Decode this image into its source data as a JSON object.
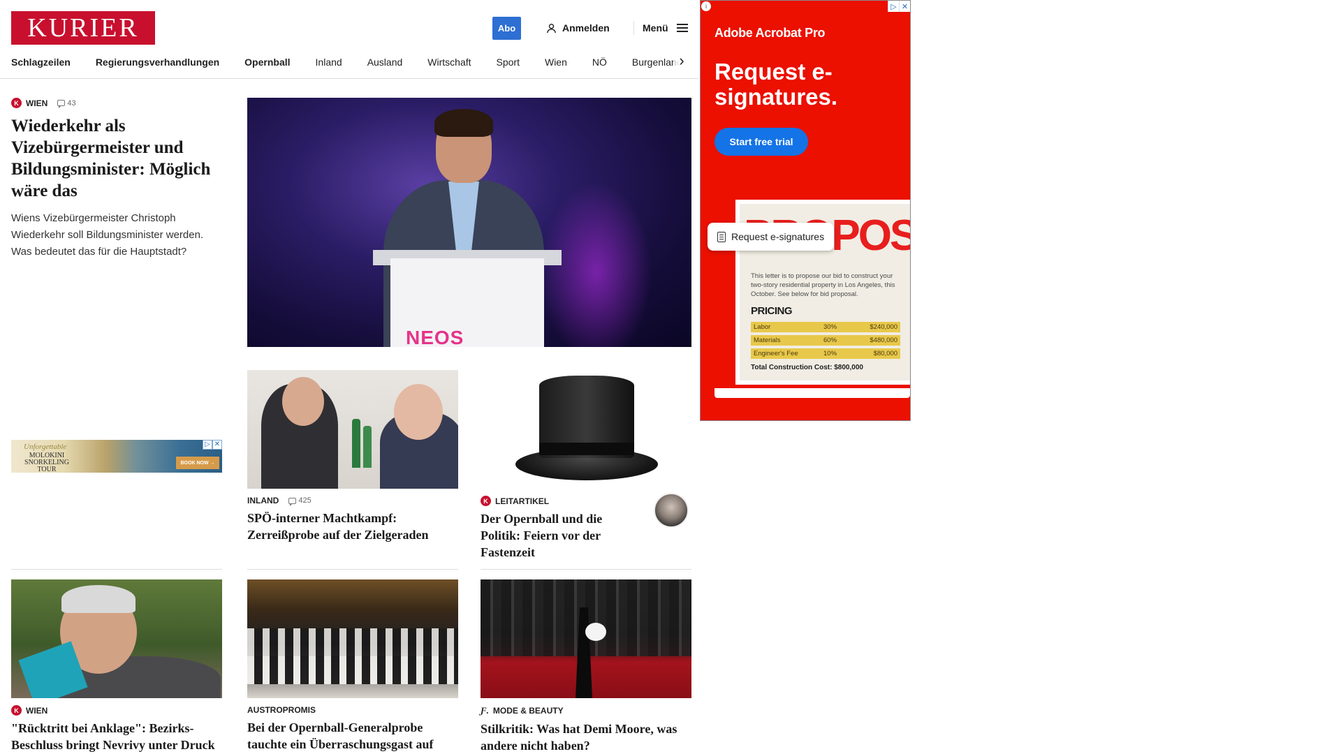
{
  "header": {
    "logo": "KURIER",
    "abo_label": "Abo",
    "login_label": "Anmelden",
    "menu_label": "Menü"
  },
  "nav": {
    "items": [
      "Schlagzeilen",
      "Regierungsverhandlungen",
      "Opernball",
      "Inland",
      "Ausland",
      "Wirtschaft",
      "Sport",
      "Wien",
      "NÖ",
      "Burgenland"
    ]
  },
  "lead": {
    "category": "WIEN",
    "comments": "43",
    "title": "Wiederkehr als Vizebürgermeister und Bildungsminister: Möglich wäre das",
    "teaser": "Wiens Vizebürgermeister Christoph Wiederkehr soll Bildungsminister werden. Was bedeutet das für die Hauptstadt?"
  },
  "hero": {
    "podium_text": "NEOS"
  },
  "articles": [
    {
      "category": "INLAND",
      "comments": "425",
      "title": "SPÖ-interner Machtkampf: Zerreißprobe auf der Zielgeraden"
    },
    {
      "category": "LEITARTIKEL",
      "title": "Der Opernball und die Politik: Feiern vor der Fastenzeit"
    },
    {
      "category": "WIEN",
      "title": "\"Rücktritt bei Anklage\": Bezirks-Beschluss bringt Nevrivy unter Druck"
    },
    {
      "category": "AUSTROPROMIS",
      "title": "Bei der Opernball-Generalprobe tauchte ein Überraschungsgast auf"
    },
    {
      "category": "MODE & BEAUTY",
      "title": "Stilkritik: Was hat Demi Moore, was andere nicht haben?"
    }
  ],
  "small_ad": {
    "line1": "Unforgettable",
    "line2": "MOLOKINI SNORKELING TOUR",
    "cta": "BOOK NOW →"
  },
  "big_ad": {
    "brand": "Adobe Acrobat Pro",
    "headline": "Request e-signatures.",
    "cta": "Start free trial",
    "doc_title": "PROPOSAL",
    "pill": "Request e-signatures",
    "letter": "This letter is to propose our bid to construct your two-story residential property in Los Angeles, this October. See below for bid proposal.",
    "pricing_title": "PRICING",
    "rows": [
      {
        "label": "Labor",
        "pct": "30%",
        "amount": "$240,000"
      },
      {
        "label": "Materials",
        "pct": "60%",
        "amount": "$480,000"
      },
      {
        "label": "Engineer's Fee",
        "pct": "10%",
        "amount": "$80,000"
      }
    ],
    "total": "Total Construction Cost: $800,000"
  },
  "colors": {
    "brand_red": "#c8102e",
    "abo_blue": "#2d6fd3",
    "ad_red": "#eb1000",
    "ad_button_blue": "#1473e6"
  }
}
